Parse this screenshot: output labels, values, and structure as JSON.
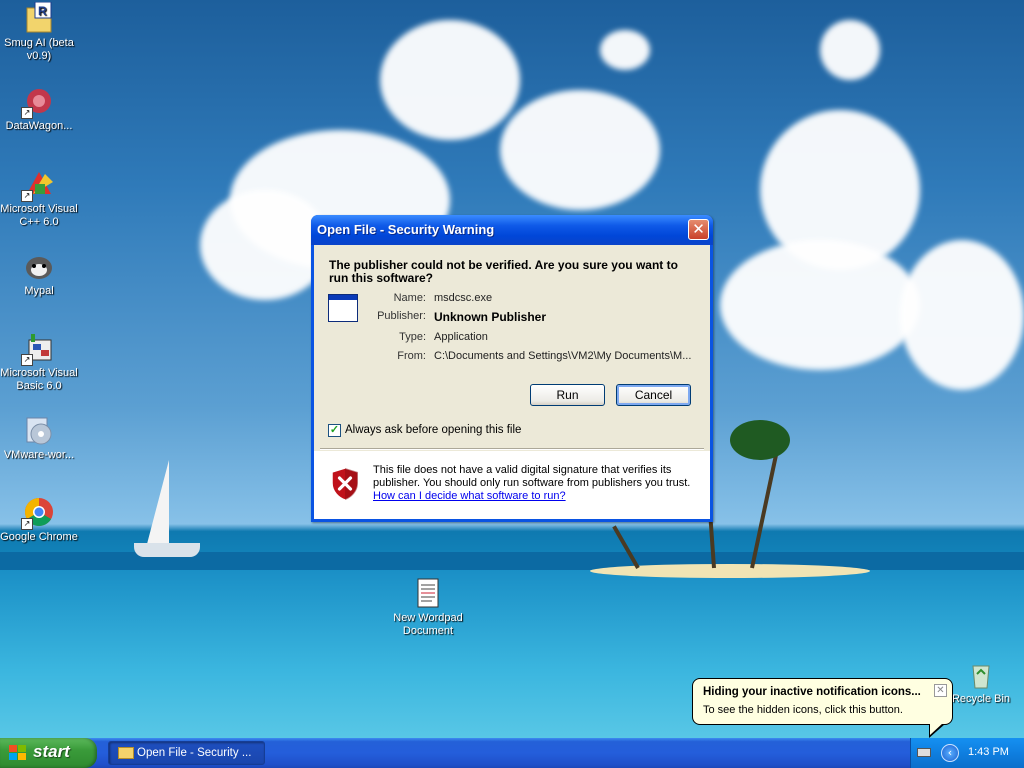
{
  "desktop": {
    "icons": [
      {
        "label": "Smug AI (beta v0.9)",
        "icon": "document-r-icon"
      },
      {
        "label": "DataWagon...",
        "icon": "datawagon-icon"
      },
      {
        "label": "Microsoft Visual C++ 6.0",
        "icon": "visual-cpp-icon"
      },
      {
        "label": "Mypal",
        "icon": "mypal-icon"
      },
      {
        "label": "Microsoft Visual Basic 6.0",
        "icon": "visual-basic-icon"
      },
      {
        "label": "VMware-wor...",
        "icon": "vmware-icon"
      },
      {
        "label": "Google Chrome",
        "icon": "chrome-icon"
      },
      {
        "label": "New Wordpad Document",
        "icon": "wordpad-document-icon"
      },
      {
        "label": "Recycle Bin",
        "icon": "recycle-bin-icon"
      }
    ]
  },
  "dialog": {
    "title": "Open File - Security Warning",
    "close_glyph": "✕",
    "question": "The publisher could not be verified.  Are you sure you want to run this software?",
    "name_label": "Name:",
    "name_value": "msdcsc.exe",
    "publisher_label": "Publisher:",
    "publisher_value": "Unknown Publisher",
    "type_label": "Type:",
    "type_value": "Application",
    "from_label": "From:",
    "from_value": "C:\\Documents and Settings\\VM2\\My Documents\\M...",
    "run_label": "Run",
    "cancel_label": "Cancel",
    "always_ask_label": "Always ask before opening this file",
    "always_ask_checked": true,
    "warning_text": "This file does not have a valid digital signature that verifies its publisher.  You should only run software from publishers you trust.",
    "help_link": "How can I decide what software to run?"
  },
  "balloon": {
    "title": "Hiding your inactive notification icons...",
    "text": "To see the hidden icons, click this button.",
    "close_glyph": "✕"
  },
  "taskbar": {
    "start_label": "start",
    "task_label": "Open File - Security ...",
    "clock": "1:43 PM",
    "show_hidden_glyph": "‹"
  },
  "colors": {
    "titlebar": "#0a54e3",
    "dialog_bg": "#ece9d8",
    "taskbar": "#245edb",
    "start_green": "#3a9b3a",
    "link": "#0000ee"
  }
}
